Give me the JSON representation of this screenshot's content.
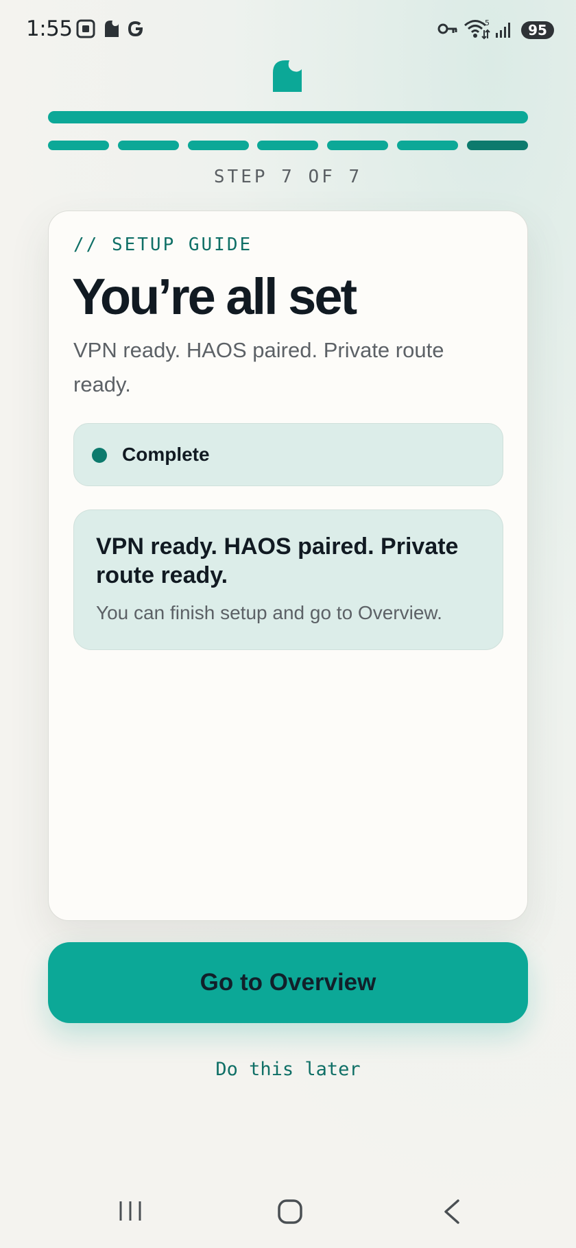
{
  "status_bar": {
    "time": "1:55",
    "battery": "95",
    "left_icons": [
      "screenshot-icon",
      "notification-icon",
      "google-icon"
    ],
    "right_icons": [
      "vpn-key-icon",
      "wifi-icon",
      "signal-icon"
    ]
  },
  "logo_icon": "app-logo-icon",
  "progress": {
    "current_step": 7,
    "total_steps": 7,
    "step_label": "STEP 7 OF 7"
  },
  "card": {
    "eyebrow": "// SETUP GUIDE",
    "title": "You’re all set",
    "subtitle": "VPN ready. HAOS paired. Private route ready.",
    "status": {
      "label": "Complete",
      "color": "#0d7a6d"
    },
    "info": {
      "title": "VPN ready. HAOS paired. Private route ready.",
      "body": "You can finish setup and go to Overview."
    }
  },
  "actions": {
    "primary": "Go to Overview",
    "secondary": "Do this later"
  },
  "nav_bar": [
    "recents-icon",
    "home-icon",
    "back-icon"
  ],
  "colors": {
    "accent": "#0ca897",
    "accent_dark": "#0d7a6d",
    "text": "#111a22",
    "muted": "#5c6166"
  }
}
